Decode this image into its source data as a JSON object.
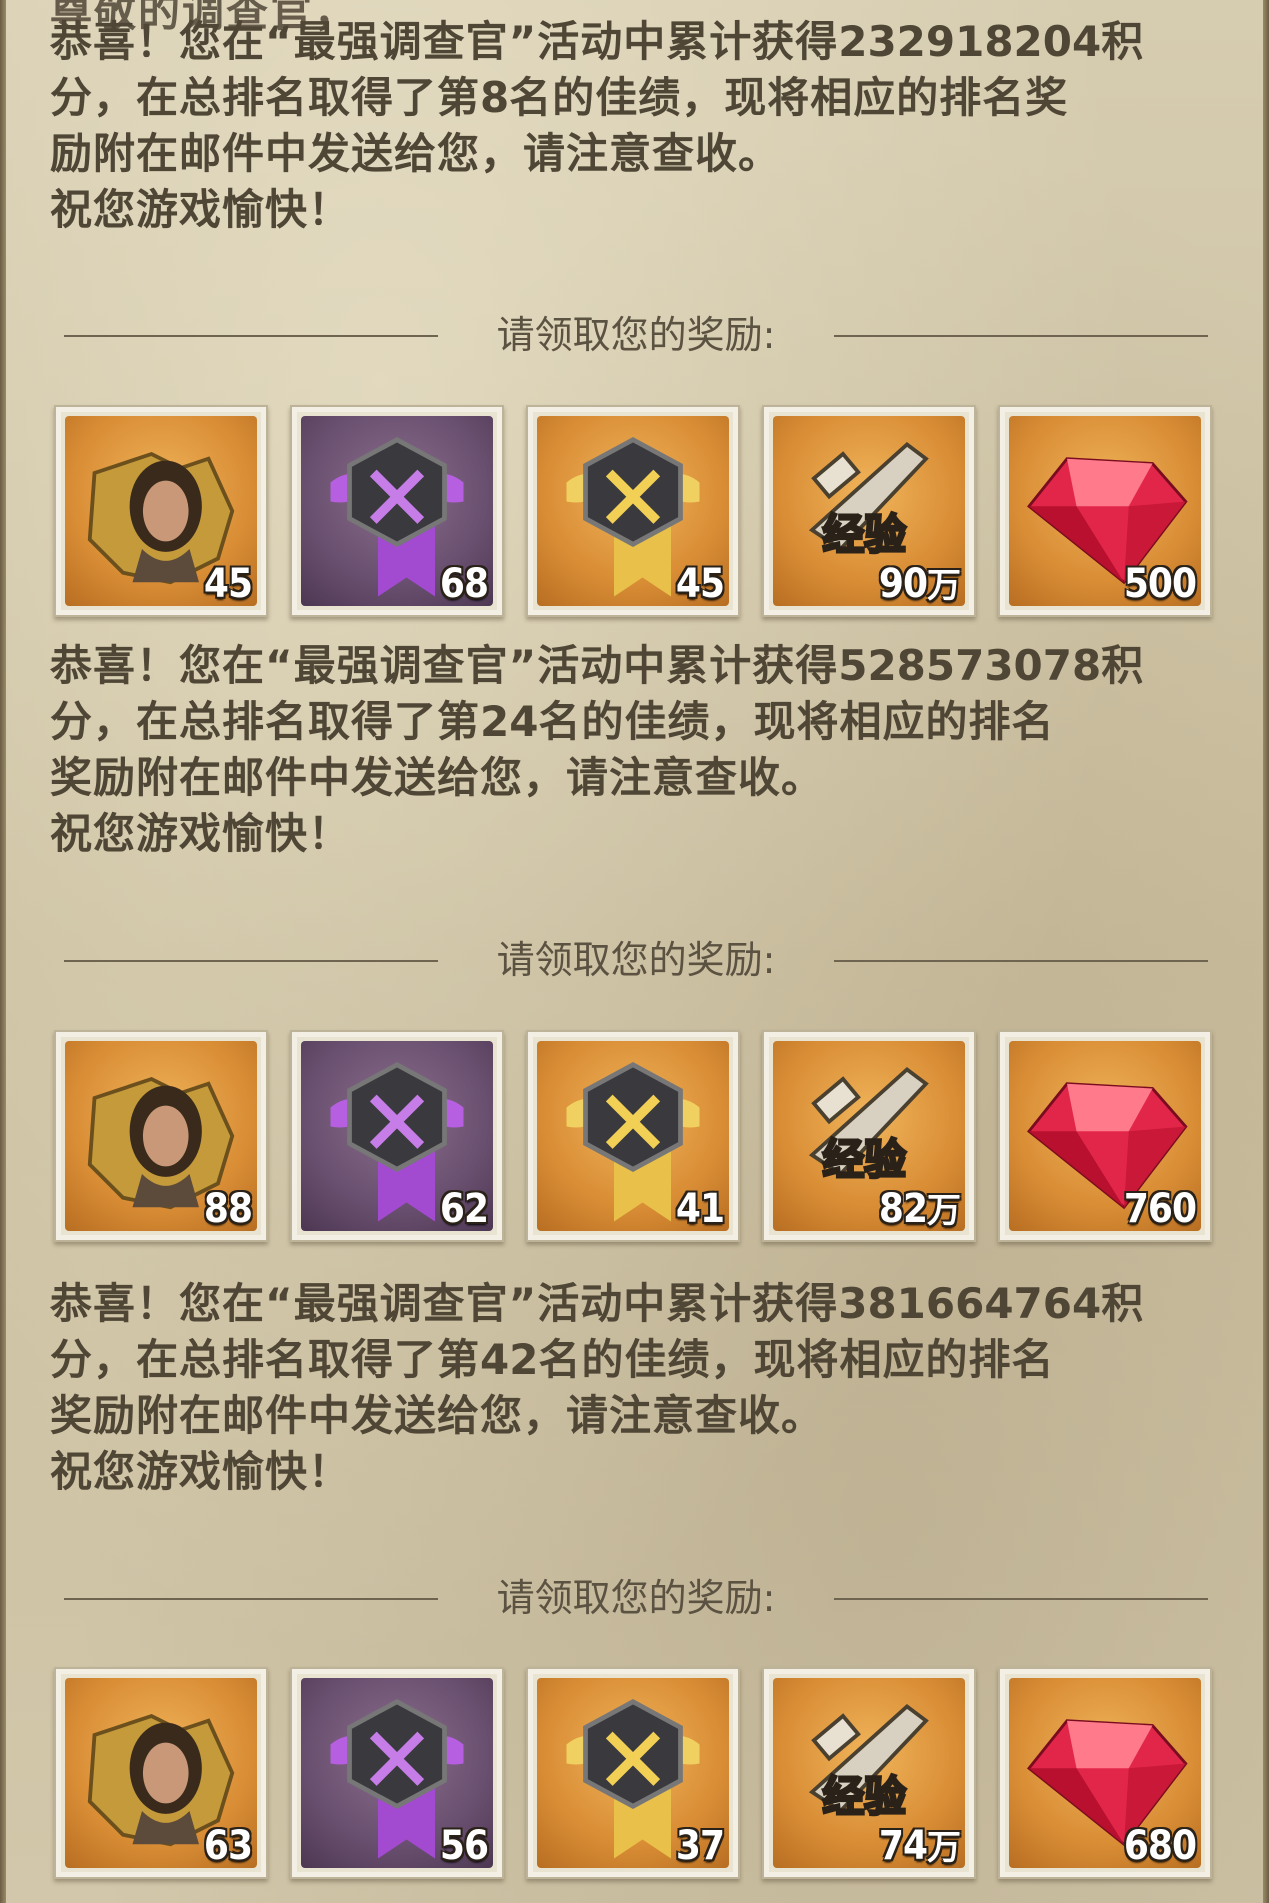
{
  "top_cutoff_text": "尊敬的调查官，",
  "mails": [
    {
      "greeting_prefix": "恭喜！您在“最强调查官”活动中累计获得",
      "points": "232918204",
      "line1_tail": "积",
      "line2_prefix": "分，在总排名取得了第",
      "rank": "8",
      "line2_tail": "名的佳绩，现将相应的排名奖",
      "line3": "励附在邮件中发送给您，请注意查收。",
      "closing": "祝您游戏愉快！",
      "divider_label": "请领取您的奖励:",
      "rewards": [
        {
          "icon": "character-fragment-icon",
          "quantity": "45",
          "unit": ""
        },
        {
          "icon": "purple-weapon-badge-icon",
          "quantity": "68",
          "unit": ""
        },
        {
          "icon": "gold-weapon-badge-icon",
          "quantity": "45",
          "unit": ""
        },
        {
          "icon": "weapon-exp-icon",
          "quantity": "90",
          "unit": "万"
        },
        {
          "icon": "ruby-gem-icon",
          "quantity": "500",
          "unit": ""
        }
      ]
    },
    {
      "greeting_prefix": "恭喜！您在“最强调查官”活动中累计获得",
      "points": "528573078",
      "line1_tail": "积",
      "line2_prefix": "分，在总排名取得了第",
      "rank": "24",
      "line2_tail": "名的佳绩，现将相应的排名",
      "line3": "奖励附在邮件中发送给您，请注意查收。",
      "closing": "祝您游戏愉快！",
      "divider_label": "请领取您的奖励:",
      "rewards": [
        {
          "icon": "character-fragment-icon",
          "quantity": "88",
          "unit": ""
        },
        {
          "icon": "purple-weapon-badge-icon",
          "quantity": "62",
          "unit": ""
        },
        {
          "icon": "gold-weapon-badge-icon",
          "quantity": "41",
          "unit": ""
        },
        {
          "icon": "weapon-exp-icon",
          "quantity": "82",
          "unit": "万"
        },
        {
          "icon": "ruby-gem-icon",
          "quantity": "760",
          "unit": ""
        }
      ]
    },
    {
      "greeting_prefix": "恭喜！您在“最强调查官”活动中累计获得",
      "points": "381664764",
      "line1_tail": "积",
      "line2_prefix": "分，在总排名取得了第",
      "rank": "42",
      "line2_tail": "名的佳绩，现将相应的排名",
      "line3": "奖励附在邮件中发送给您，请注意查收。",
      "closing": "祝您游戏愉快！",
      "divider_label": "请领取您的奖励:",
      "rewards": [
        {
          "icon": "character-fragment-icon",
          "quantity": "63",
          "unit": ""
        },
        {
          "icon": "purple-weapon-badge-icon",
          "quantity": "56",
          "unit": ""
        },
        {
          "icon": "gold-weapon-badge-icon",
          "quantity": "37",
          "unit": ""
        },
        {
          "icon": "weapon-exp-icon",
          "quantity": "74",
          "unit": "万"
        },
        {
          "icon": "ruby-gem-icon",
          "quantity": "680",
          "unit": ""
        }
      ]
    }
  ],
  "exp_badge_text": "经验",
  "colors": {
    "parchment": "#cfc4a7",
    "text": "#4f4636",
    "gold_tile": "#d98d35",
    "purple_tile": "#6a5070",
    "ruby": "#e2264a"
  }
}
